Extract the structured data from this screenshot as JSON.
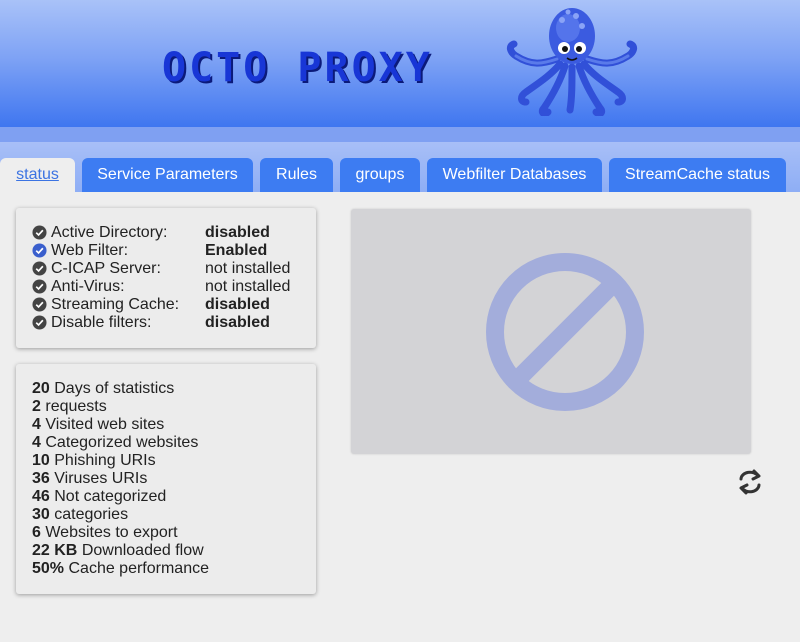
{
  "header": {
    "logo_text": "OCTO PROXY"
  },
  "tabs": [
    {
      "label": "status",
      "active": true
    },
    {
      "label": "Service Parameters",
      "active": false
    },
    {
      "label": "Rules",
      "active": false
    },
    {
      "label": "groups",
      "active": false
    },
    {
      "label": "Webfilter Databases",
      "active": false
    },
    {
      "label": "StreamCache status",
      "active": false
    }
  ],
  "services": [
    {
      "label": "Active Directory:",
      "value": "disabled",
      "bold": true,
      "icon": "check-circle-icon",
      "icon_color": "#444444"
    },
    {
      "label": "Web Filter:",
      "value": "Enabled",
      "bold": true,
      "icon": "check-circle-icon",
      "icon_color": "#3a5fcd"
    },
    {
      "label": "C-ICAP Server:",
      "value": "not installed",
      "bold": false,
      "icon": "check-circle-icon",
      "icon_color": "#444444"
    },
    {
      "label": "Anti-Virus:",
      "value": "not installed",
      "bold": false,
      "icon": "check-circle-icon",
      "icon_color": "#444444"
    },
    {
      "label": "Streaming Cache:",
      "value": "disabled",
      "bold": true,
      "icon": "check-circle-icon",
      "icon_color": "#444444"
    },
    {
      "label": "Disable filters:",
      "value": "disabled",
      "bold": true,
      "icon": "check-circle-icon",
      "icon_color": "#444444"
    }
  ],
  "stats": [
    {
      "value": "20",
      "label": "Days of statistics"
    },
    {
      "value": "2",
      "label": "requests"
    },
    {
      "value": "4",
      "label": "Visited web sites"
    },
    {
      "value": "4",
      "label": "Categorized websites"
    },
    {
      "value": "10",
      "label": "Phishing URIs"
    },
    {
      "value": "36",
      "label": "Viruses URIs"
    },
    {
      "value": "46",
      "label": "Not categorized"
    },
    {
      "value": "30",
      "label": "categories"
    },
    {
      "value": "6",
      "label": "Websites to export"
    },
    {
      "value": "22 KB",
      "label": "Downloaded flow"
    },
    {
      "value": "50%",
      "label": "Cache performance"
    }
  ],
  "chart_placeholder": {
    "icon": "no-image-icon",
    "color": "#a3addb"
  },
  "refresh": {
    "icon": "refresh-icon"
  },
  "colors": {
    "tab_bg": "#3d7cf2",
    "active_tab_text": "#3b73e2",
    "logo": "#1836d6"
  }
}
